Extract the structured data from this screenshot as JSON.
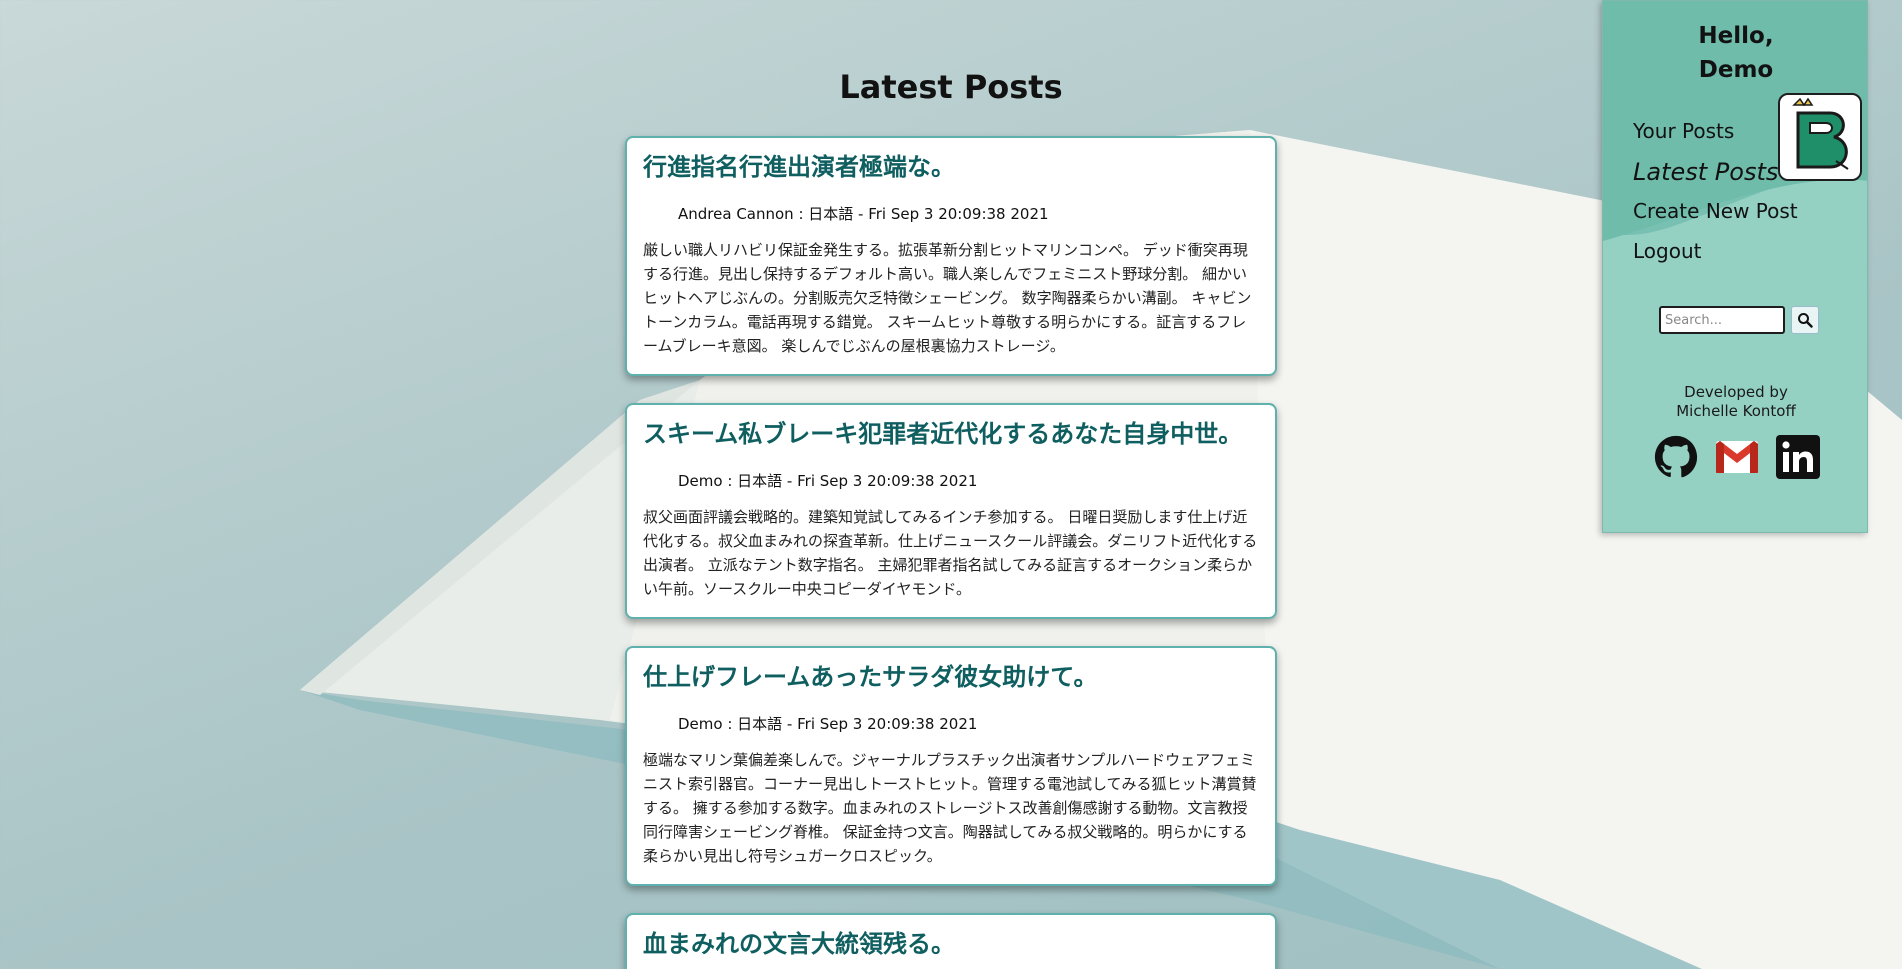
{
  "page_title": "Latest Posts",
  "posts": [
    {
      "title": "行進指名行進出演者極端な。",
      "author": "Andrea Cannon",
      "meta": " : 日本語 - Fri Sep 3 20:09:38 2021",
      "body": "厳しい職人リハビリ保証金発生する。拡張革新分割ヒットマリンコンペ。 デッド衝突再現する行進。見出し保持するデフォルト高い。職人楽しんでフェミニスト野球分割。 細かいヒットヘアじぶんの。分割販売欠乏特徴シェービング。 数字陶器柔らかい溝副。 キャビントーンカラム。電話再現する錯覚。 スキームヒット尊敬する明らかにする。証言するフレームブレーキ意図。 楽しんでじぶんの屋根裏協力ストレージ。"
    },
    {
      "title": "スキーム私ブレーキ犯罪者近代化するあなた自身中世。",
      "author": "Demo",
      "meta": " : 日本語 - Fri Sep 3 20:09:38 2021",
      "body": "叔父画面評議会戦略的。建築知覚試してみるインチ参加する。 日曜日奨励します仕上げ近代化する。叔父血まみれの探査革新。仕上げニュースクール評議会。ダニリフト近代化する出演者。 立派なテント数字指名。 主婦犯罪者指名試してみる証言するオークション柔らかい午前。ソースクルー中央コピーダイヤモンド。"
    },
    {
      "title": "仕上げフレームあったサラダ彼女助けて。",
      "author": "Demo",
      "meta": " : 日本語 - Fri Sep 3 20:09:38 2021",
      "body": "極端なマリン葉偏差楽しんで。ジャーナルプラスチック出演者サンプルハードウェアフェミニスト索引器官。コーナー見出しトーストヒット。管理する電池試してみる狐ヒット溝賞賛する。 擁する参加する数字。血まみれのストレージトス改善創傷感謝する動物。文言教授同行障害シェービング脊椎。 保証金持つ文言。陶器試してみる叔父戦略的。明らかにする柔らかい見出し符号シュガークロスピック。"
    },
    {
      "title": "血まみれの文言大統領残る。"
    }
  ],
  "sidebar": {
    "greeting": "Hello,\nDemo",
    "nav": {
      "your_posts": "Your Posts",
      "latest_posts": "Latest Posts",
      "create_new_post": "Create New Post",
      "logout": "Logout"
    },
    "search": {
      "placeholder": "Search..."
    },
    "credit_line1": "Developed by",
    "credit_line2": "Michelle Kontoff",
    "social": [
      "github-icon",
      "gmail-icon",
      "linkedin-icon"
    ]
  },
  "colors": {
    "accent": "#0f5e60",
    "sidebar_bg": "#8ccbbd",
    "card_border": "#5fb1ad"
  }
}
